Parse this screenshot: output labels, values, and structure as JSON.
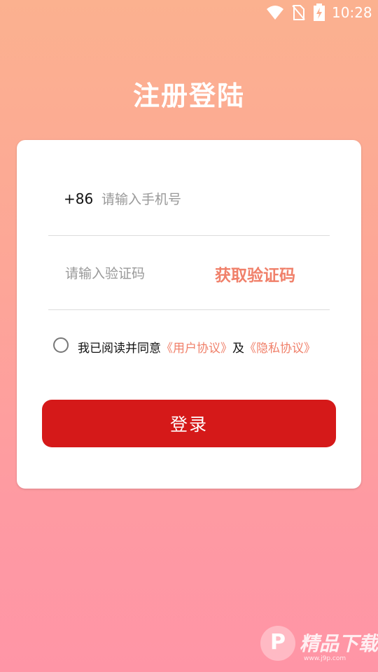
{
  "status_bar": {
    "time": "10:28",
    "icons": [
      "wifi-icon",
      "no-sim-icon",
      "battery-charging-icon"
    ]
  },
  "page": {
    "title": "注册登陆"
  },
  "form": {
    "country_code": "+86",
    "phone_placeholder": "请输入手机号",
    "code_placeholder": "请输入验证码",
    "get_code_label": "获取验证码",
    "agreement": {
      "prefix": "我已阅读并同意",
      "user_agreement": "《用户协议》",
      "conjunction": "及",
      "privacy_policy": "《隐私协议》",
      "checked": false
    },
    "login_label": "登录"
  },
  "watermark": {
    "text": "精品下载",
    "url": "www.j9p.com"
  },
  "colors": {
    "gradient_top": "#fbb18f",
    "gradient_bottom": "#ff95a6",
    "accent_link": "#f0806a",
    "login_button": "#d51919"
  }
}
